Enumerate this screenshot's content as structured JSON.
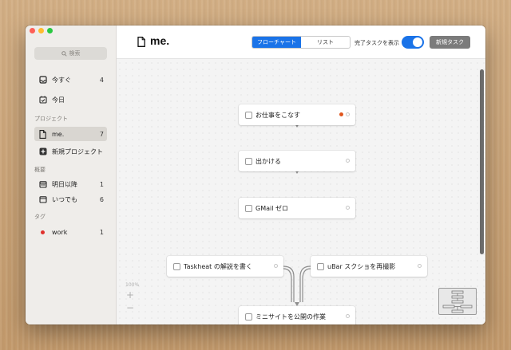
{
  "window": {
    "controls": [
      "close",
      "minimize",
      "zoom"
    ]
  },
  "sidebar": {
    "search_placeholder": "検索",
    "top_items": [
      {
        "label": "今すぐ",
        "count": "4",
        "icon": "inbox-icon"
      },
      {
        "label": "今日",
        "count": "",
        "icon": "calendar-check-icon"
      }
    ],
    "projects_header": "プロジェクト",
    "projects": [
      {
        "label": "me.",
        "count": "7",
        "icon": "document-icon",
        "selected": true
      },
      {
        "label": "新規プロジェクト",
        "count": "",
        "icon": "plus-square-icon"
      }
    ],
    "overview_header": "概要",
    "overview": [
      {
        "label": "明日以降",
        "count": "1",
        "icon": "calendar-icon"
      },
      {
        "label": "いつでも",
        "count": "6",
        "icon": "calendar-icon"
      }
    ],
    "tags_header": "タグ",
    "tags": [
      {
        "label": "work",
        "count": "1",
        "color": "#e0302c"
      }
    ]
  },
  "toolbar": {
    "title": "me.",
    "view_tabs": [
      {
        "label": "フローチャート",
        "active": true
      },
      {
        "label": "リスト",
        "active": false
      }
    ],
    "show_completed_label": "完了タスクを表示",
    "show_completed": true,
    "new_task_label": "新規タスク"
  },
  "flowchart": {
    "nodes": [
      {
        "label": "お仕事をこなす",
        "checked": false,
        "tag_color": "#e0561e"
      },
      {
        "label": "出かける",
        "checked": false
      },
      {
        "label": "GMail ゼロ",
        "checked": false
      },
      {
        "label": "Taskheat の解説を書く",
        "checked": false
      },
      {
        "label": "uBar スクショを再撮影",
        "checked": false
      },
      {
        "label": "ミニサイトを公開の作業",
        "checked": false
      }
    ],
    "zoom_level": "100%",
    "zoom_in_label": "+",
    "zoom_out_label": "−"
  },
  "colors": {
    "accent": "#1a73e8",
    "sidebar_bg": "#efedea",
    "canvas_bg": "#f4f4f4",
    "new_task_bg": "#7b7b7b"
  }
}
